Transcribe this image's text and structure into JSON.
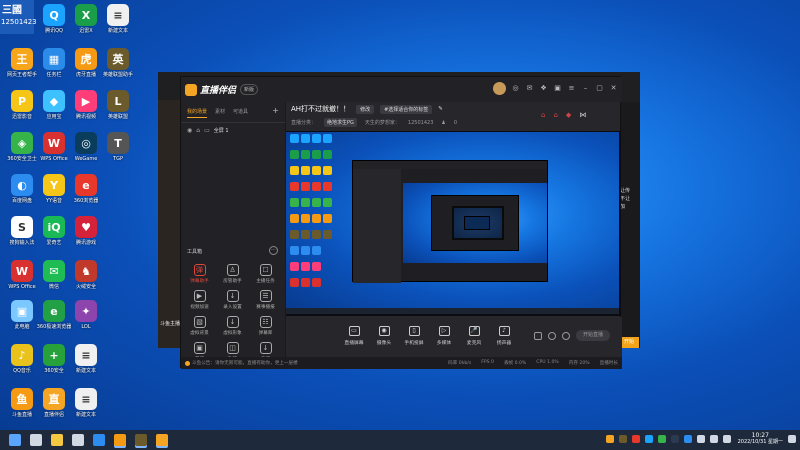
{
  "desktop": {
    "corner_logo": "三國",
    "corner_id": "12501423",
    "icons": [
      {
        "label": "腾讯QQ",
        "glyph": "Q",
        "color": "#1aa3ff"
      },
      {
        "label": "迅雷X",
        "glyph": "X",
        "color": "#1a9e4a"
      },
      {
        "label": "新建文本",
        "glyph": "≡",
        "color": "#f0f0f0"
      },
      {
        "label": "网页王者帮手",
        "glyph": "王",
        "color": "#f7a51a"
      },
      {
        "label": "任务栏",
        "glyph": "▦",
        "color": "#2b8be8"
      },
      {
        "label": "虎牙直播",
        "glyph": "虎",
        "color": "#f59a12"
      },
      {
        "label": "英雄联盟助手",
        "glyph": "英",
        "color": "#6b5a2c"
      },
      {
        "label": "迅雷影音",
        "glyph": "P",
        "color": "#f5c518"
      },
      {
        "label": "应用宝",
        "glyph": "◆",
        "color": "#3ec1ff"
      },
      {
        "label": "腾讯视频",
        "glyph": "▶",
        "color": "#ff3d78"
      },
      {
        "label": "英雄联盟",
        "glyph": "L",
        "color": "#6b5a2c"
      },
      {
        "label": "360安全卫士",
        "glyph": "◈",
        "color": "#36b44a"
      },
      {
        "label": "WPS Office",
        "glyph": "W",
        "color": "#d9312f"
      },
      {
        "label": "WeGame",
        "glyph": "◎",
        "color": "#0a3d5c"
      },
      {
        "label": "TGP",
        "glyph": "T",
        "color": "#555"
      },
      {
        "label": "百度网盘",
        "glyph": "◐",
        "color": "#2d8cf0"
      },
      {
        "label": "YY语音",
        "glyph": "Y",
        "color": "#f5c518"
      },
      {
        "label": "360浏览器",
        "glyph": "e",
        "color": "#e8382b"
      },
      {
        "label": "搜狗输入法",
        "glyph": "S",
        "color": "#fff"
      },
      {
        "label": "爱奇艺",
        "glyph": "iQ",
        "color": "#19b955"
      },
      {
        "label": "腾讯游戏",
        "glyph": "♥",
        "color": "#d4223a"
      },
      {
        "label": "WPS Office",
        "glyph": "W",
        "color": "#d9312f"
      },
      {
        "label": "微信",
        "glyph": "✉",
        "color": "#1fbc54"
      },
      {
        "label": "火绒安全",
        "glyph": "♞",
        "color": "#c0392b"
      },
      {
        "label": "此电脑",
        "glyph": "▣",
        "color": "#7bc7ff"
      },
      {
        "label": "360极速浏览器",
        "glyph": "e",
        "color": "#22a045"
      },
      {
        "label": "LOL",
        "glyph": "✦",
        "color": "#8e44ad"
      },
      {
        "label": "QQ音乐",
        "glyph": "♪",
        "color": "#e9c31c"
      },
      {
        "label": "360安全",
        "glyph": "+",
        "color": "#27a23a"
      },
      {
        "label": "新建文本",
        "glyph": "≡",
        "color": "#f0f0f0"
      },
      {
        "label": "斗鱼直播",
        "glyph": "鱼",
        "color": "#f59a12"
      },
      {
        "label": "直播伴侣",
        "glyph": "直",
        "color": "#f5a524"
      },
      {
        "label": "新建文本",
        "glyph": "≡",
        "color": "#f0f0f0"
      }
    ]
  },
  "back_window": {
    "left_text": "斗鱼主播",
    "right_text": "让传\n不让\n加",
    "orange_btn": "开始"
  },
  "app": {
    "brand_name": "直播伴侣",
    "version_badge": "新版",
    "sidebar": {
      "tabs": [
        "我的场景",
        "素材",
        "可道具"
      ],
      "add": "+",
      "scene_name": "全屏 1",
      "tools_title": "工具箱",
      "tools_more": "···",
      "tools": [
        {
          "label": "弹幕助手",
          "glyph": "弹",
          "hot": true
        },
        {
          "label": "房管助手",
          "glyph": "♙",
          "hot": false
        },
        {
          "label": "主播任务",
          "glyph": "☐",
          "hot": false
        },
        {
          "label": "视频加速",
          "glyph": "▶",
          "hot": false
        },
        {
          "label": "录入设置",
          "glyph": "↓",
          "hot": false
        },
        {
          "label": "赛事播报",
          "glyph": "☰",
          "hot": false
        },
        {
          "label": "虚拟背景",
          "glyph": "▧",
          "hot": false
        },
        {
          "label": "虚拟形象",
          "glyph": "↓",
          "hot": false
        },
        {
          "label": "弹幕库",
          "glyph": "☷",
          "hot": false
        },
        {
          "label": "开播",
          "glyph": "▣",
          "hot": false
        },
        {
          "label": "礼物",
          "glyph": "◫",
          "hot": false
        },
        {
          "label": "直播",
          "glyph": "↓",
          "hot": false
        }
      ]
    },
    "stream": {
      "title": "AH打不过就撤！！",
      "tag1": "修改",
      "tag2": "#选择适合你的标签",
      "category_label": "直播分类：",
      "category": "绝地求生PG",
      "room_label": "天生的梦想家：",
      "room_id": "12501423",
      "fans": "0"
    },
    "controls": [
      {
        "label": "直播屏幕",
        "glyph": "▭"
      },
      {
        "label": "摄像头",
        "glyph": "◉"
      },
      {
        "label": "手机投屏",
        "glyph": "▯"
      },
      {
        "label": "多媒体",
        "glyph": "▷"
      },
      {
        "label": "麦克风",
        "glyph": "🎤"
      },
      {
        "label": "扬声器",
        "glyph": "♪"
      }
    ],
    "start_button": "开始直播",
    "status": {
      "tip": "斗鱼公告：请你无限可能，直播有助你，更上一层楼",
      "stats": [
        "码率 0kb/s",
        "FPS 0",
        "丢帧 0.0%",
        "CPU 1.0%",
        "内存 20%",
        "直播时长"
      ]
    }
  },
  "taskbar": {
    "apps": [
      {
        "name": "windows-start",
        "color": "#5aa6ff"
      },
      {
        "name": "search",
        "color": "#cfd8e3"
      },
      {
        "name": "file-explorer",
        "color": "#f5c842"
      },
      {
        "name": "store",
        "color": "#cfd8e3"
      },
      {
        "name": "edge",
        "color": "#2d8cf0"
      },
      {
        "name": "douyu",
        "color": "#f59a12"
      },
      {
        "name": "lol",
        "color": "#6b5a2c"
      },
      {
        "name": "zhibo",
        "color": "#f5a524"
      }
    ],
    "time": "10:27",
    "date": "2022/10/31 星期一"
  }
}
